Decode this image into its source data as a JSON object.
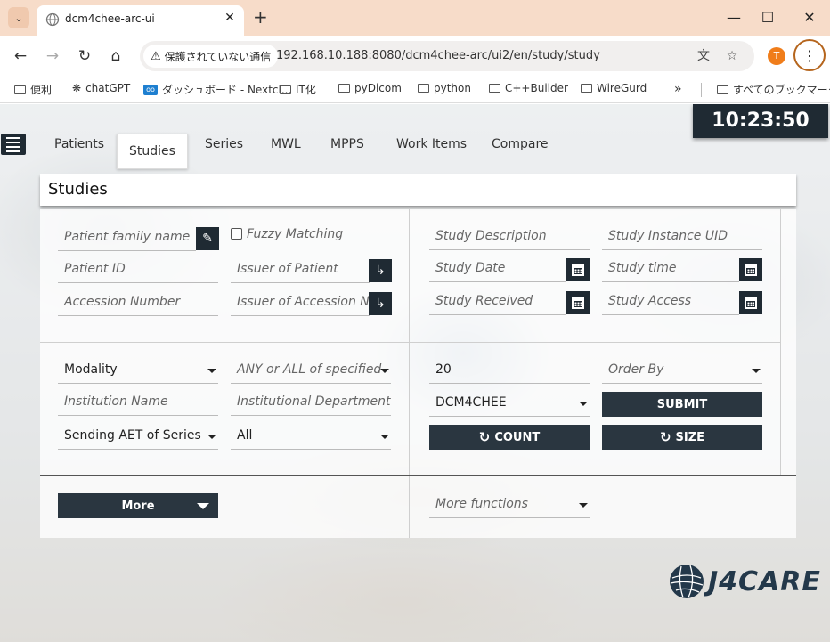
{
  "browser": {
    "tab_title": "dcm4chee-arc-ui",
    "security_label": "保護されていない通信",
    "url": "192.168.10.188:8080/dcm4chee-arc/ui2/en/study/study",
    "profile_initial": "T",
    "bookmarks": [
      "便利",
      "chatGPT",
      "ダッシュボード - Nextcl...",
      "IT化",
      "pyDicom",
      "python",
      "C++Builder",
      "WireGurd"
    ],
    "bookmarks_overflow": "»",
    "all_bookmarks": "すべてのブックマーク"
  },
  "app": {
    "clock": "10:23:50",
    "nav_tabs": [
      "Patients",
      "Studies",
      "Series",
      "MWL",
      "MPPS",
      "Work Items",
      "Compare"
    ],
    "active_tab": "Studies",
    "page_title": "Studies"
  },
  "filters": {
    "patient_family_name": "Patient family name",
    "fuzzy_matching": "Fuzzy Matching",
    "patient_id": "Patient ID",
    "issuer_of_patient": "Issuer of Patient",
    "accession_number": "Accession Number",
    "issuer_of_accession_number": "Issuer of Accession Number",
    "study_description": "Study Description",
    "study_instance_uid": "Study Instance UID",
    "study_date": "Study Date",
    "study_time": "Study time",
    "study_received": "Study Received",
    "study_access": "Study Access",
    "modality": "Modality",
    "any_or_all": "ANY or ALL of specified",
    "institution_name": "Institution Name",
    "institutional_department": "Institutional Department Name",
    "sending_aet": "Sending AET of Series",
    "sending_aet_value": "All",
    "limit": "20",
    "order_by": "Order By",
    "aet": "DCM4CHEE",
    "more_functions": "More functions"
  },
  "buttons": {
    "submit": "SUBMIT",
    "count": "COUNT",
    "size": "SIZE",
    "more": "More"
  },
  "logo_text": "J4CARE",
  "colors": {
    "dark": "#1f2a33",
    "tabstrip": "#f7dcc9",
    "accent_profile": "#f07d1a"
  }
}
